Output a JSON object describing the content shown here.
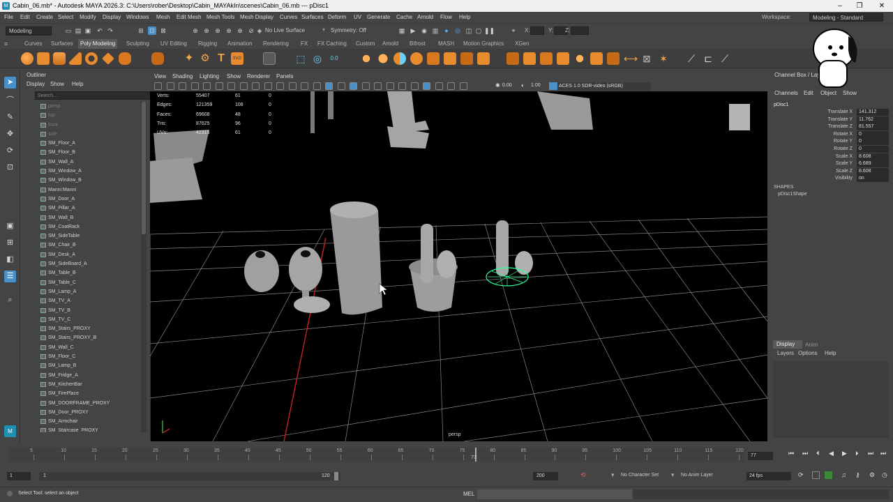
{
  "titlebar": {
    "title": "Cabin_06.mb* - Autodesk MAYA 2026.3: C:\\Users\\rober\\Desktop\\Cabin_MAYAkIn\\scenes\\Cabin_06.mb  ---  pDisc1",
    "minimize": "–",
    "maximize": "❐",
    "close": "✕"
  },
  "menubar": {
    "items": [
      "File",
      "Edit",
      "Create",
      "Select",
      "Modify",
      "Display",
      "Windows",
      "Mesh",
      "Edit Mesh",
      "Mesh Tools",
      "Mesh Display",
      "Curves",
      "Surfaces",
      "Deform",
      "UV",
      "Generate",
      "Cache",
      "Arnold",
      "Flow",
      "Help"
    ],
    "workspace_label": "Workspace:",
    "workspace_value": "Modeling - Standard"
  },
  "statusline": {
    "menuset": "Modeling",
    "live_surface": "No Live Surface",
    "symmetry": "Symmetry: Off",
    "x_label": "X:",
    "y_label": "Y:",
    "z_label": "Z:"
  },
  "shelf": {
    "tabs": [
      "Curves",
      "Surfaces",
      "Poly Modeling",
      "Sculpting",
      "UV Editing",
      "Rigging",
      "Animation",
      "Rendering",
      "FX",
      "FX Caching",
      "Custom",
      "Arnold",
      "Bifrost",
      "MASH",
      "Motion Graphics",
      "XGen"
    ],
    "active_tab": "Poly Modeling"
  },
  "outliner": {
    "title": "Outliner",
    "menus": [
      "Display",
      "Show",
      "Help"
    ],
    "search_placeholder": "Search...",
    "items": [
      {
        "label": "persp",
        "dim": true
      },
      {
        "label": "top",
        "dim": true
      },
      {
        "label": "front",
        "dim": true
      },
      {
        "label": "side",
        "dim": true
      },
      {
        "label": "SM_Floor_A",
        "dim": false
      },
      {
        "label": "SM_Floor_B",
        "dim": false
      },
      {
        "label": "SM_Wall_A",
        "dim": false
      },
      {
        "label": "SM_Window_A",
        "dim": false
      },
      {
        "label": "SM_Window_B",
        "dim": false
      },
      {
        "label": "Manni:Manni",
        "dim": false
      },
      {
        "label": "SM_Door_A",
        "dim": false
      },
      {
        "label": "SM_Pillar_A",
        "dim": false
      },
      {
        "label": "SM_Wall_B",
        "dim": false
      },
      {
        "label": "SM_CoatRack",
        "dim": false
      },
      {
        "label": "SM_SideTable",
        "dim": false
      },
      {
        "label": "SM_Chair_B",
        "dim": false
      },
      {
        "label": "SM_Desk_A",
        "dim": false
      },
      {
        "label": "SM_SideBoard_A",
        "dim": false
      },
      {
        "label": "SM_Table_B",
        "dim": false
      },
      {
        "label": "SM_Table_C",
        "dim": false
      },
      {
        "label": "SM_Lamp_A",
        "dim": false
      },
      {
        "label": "SM_TV_A",
        "dim": false
      },
      {
        "label": "SM_TV_B",
        "dim": false
      },
      {
        "label": "SM_TV_C",
        "dim": false
      },
      {
        "label": "SM_Stairs_PROXY",
        "dim": false
      },
      {
        "label": "SM_Stairs_PROXY_B",
        "dim": false
      },
      {
        "label": "SM_Wall_C",
        "dim": false
      },
      {
        "label": "SM_Floor_C",
        "dim": false
      },
      {
        "label": "SM_Lamp_B",
        "dim": false
      },
      {
        "label": "SM_Fridge_A",
        "dim": false
      },
      {
        "label": "SM_KitchenBar",
        "dim": false
      },
      {
        "label": "SM_FirePlace",
        "dim": false
      },
      {
        "label": "SM_DOORFRAME_PROXY",
        "dim": false
      },
      {
        "label": "SM_Door_PROXY",
        "dim": false
      },
      {
        "label": "SM_Armchair",
        "dim": false
      },
      {
        "label": "SM_Staircase_PROXY",
        "dim": false
      }
    ]
  },
  "viewport": {
    "menus": [
      "View",
      "Shading",
      "Lighting",
      "Show",
      "Renderer",
      "Panels"
    ],
    "exposure": "0.00",
    "gamma": "1.00",
    "color_space": "ACES 1.0 SDR-video (sRGB)",
    "camera_label": "persp",
    "hud": [
      {
        "label": "Verts:",
        "a": "55407",
        "b": "61",
        "c": "0"
      },
      {
        "label": "Edges:",
        "a": "121359",
        "b": "108",
        "c": "0"
      },
      {
        "label": "Faces:",
        "a": "69608",
        "b": "48",
        "c": "0"
      },
      {
        "label": "Tris:",
        "a": "87625",
        "b": "96",
        "c": "0"
      },
      {
        "label": "UVs:",
        "a": "42315",
        "b": "61",
        "c": "0"
      }
    ]
  },
  "channelbox": {
    "title": "Channel Box / Layer Editor",
    "menus": [
      "Channels",
      "Edit",
      "Object",
      "Show"
    ],
    "node": "pDisc1",
    "attributes": [
      {
        "label": "Translate X",
        "value": "141.312"
      },
      {
        "label": "Translate Y",
        "value": "11.762"
      },
      {
        "label": "Translate Z",
        "value": "81.557"
      },
      {
        "label": "Rotate X",
        "value": "0"
      },
      {
        "label": "Rotate Y",
        "value": "0"
      },
      {
        "label": "Rotate Z",
        "value": "0"
      },
      {
        "label": "Scale X",
        "value": "8.608"
      },
      {
        "label": "Scale Y",
        "value": "6.689"
      },
      {
        "label": "Scale Z",
        "value": "8.608"
      },
      {
        "label": "Visibility",
        "value": "on"
      }
    ],
    "shapes_label": "SHAPES",
    "shape_node": "pDisc1Shape",
    "layer_tabs": [
      "Display",
      "Anim"
    ],
    "layer_menus": [
      "Layers",
      "Options",
      "Help"
    ]
  },
  "timeslider": {
    "ticks": [
      "5",
      "10",
      "15",
      "20",
      "25",
      "30",
      "35",
      "40",
      "45",
      "50",
      "55",
      "60",
      "65",
      "70",
      "75",
      "80",
      "85",
      "90",
      "95",
      "100",
      "105",
      "110",
      "115",
      "120"
    ],
    "current_frame": "77",
    "current_frame_field": "77"
  },
  "rangeslider": {
    "start": "1",
    "inner_start": "1",
    "inner_end": "120",
    "end": "200",
    "character_set": "No Character Set",
    "anim_layer": "No Anim Layer",
    "fps": "24 fps"
  },
  "cmdline": {
    "help_text": "Select Tool: select an object",
    "lang": "MEL"
  },
  "colors": {
    "accent_blue": "#4a90c8",
    "selected_wire": "#33ff99",
    "viewport_bg": "#000000",
    "timeline_marker": "#b0b0b0"
  }
}
